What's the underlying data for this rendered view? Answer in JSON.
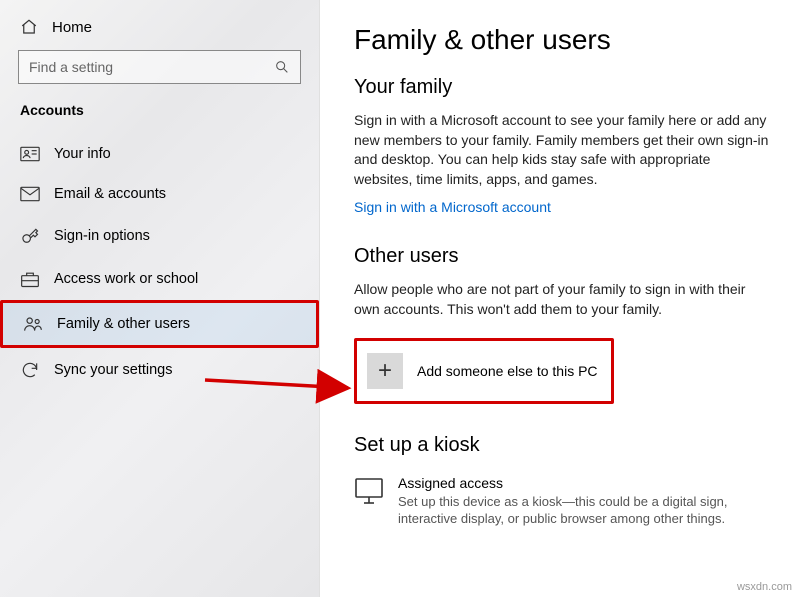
{
  "sidebar": {
    "home_label": "Home",
    "search_placeholder": "Find a setting",
    "section_title": "Accounts",
    "items": [
      {
        "label": "Your info"
      },
      {
        "label": "Email & accounts"
      },
      {
        "label": "Sign-in options"
      },
      {
        "label": "Access work or school"
      },
      {
        "label": "Family & other users"
      },
      {
        "label": "Sync your settings"
      }
    ]
  },
  "main": {
    "page_title": "Family & other users",
    "family": {
      "heading": "Your family",
      "body": "Sign in with a Microsoft account to see your family here or add any new members to your family. Family members get their own sign-in and desktop. You can help kids stay safe with appropriate websites, time limits, apps, and games.",
      "link": "Sign in with a Microsoft account"
    },
    "other": {
      "heading": "Other users",
      "body": "Allow people who are not part of your family to sign in with their own accounts. This won't add them to your family.",
      "add_label": "Add someone else to this PC"
    },
    "kiosk": {
      "heading": "Set up a kiosk",
      "title": "Assigned access",
      "desc": "Set up this device as a kiosk—this could be a digital sign, interactive display, or public browser among other things."
    }
  },
  "watermark": "wsxdn.com"
}
